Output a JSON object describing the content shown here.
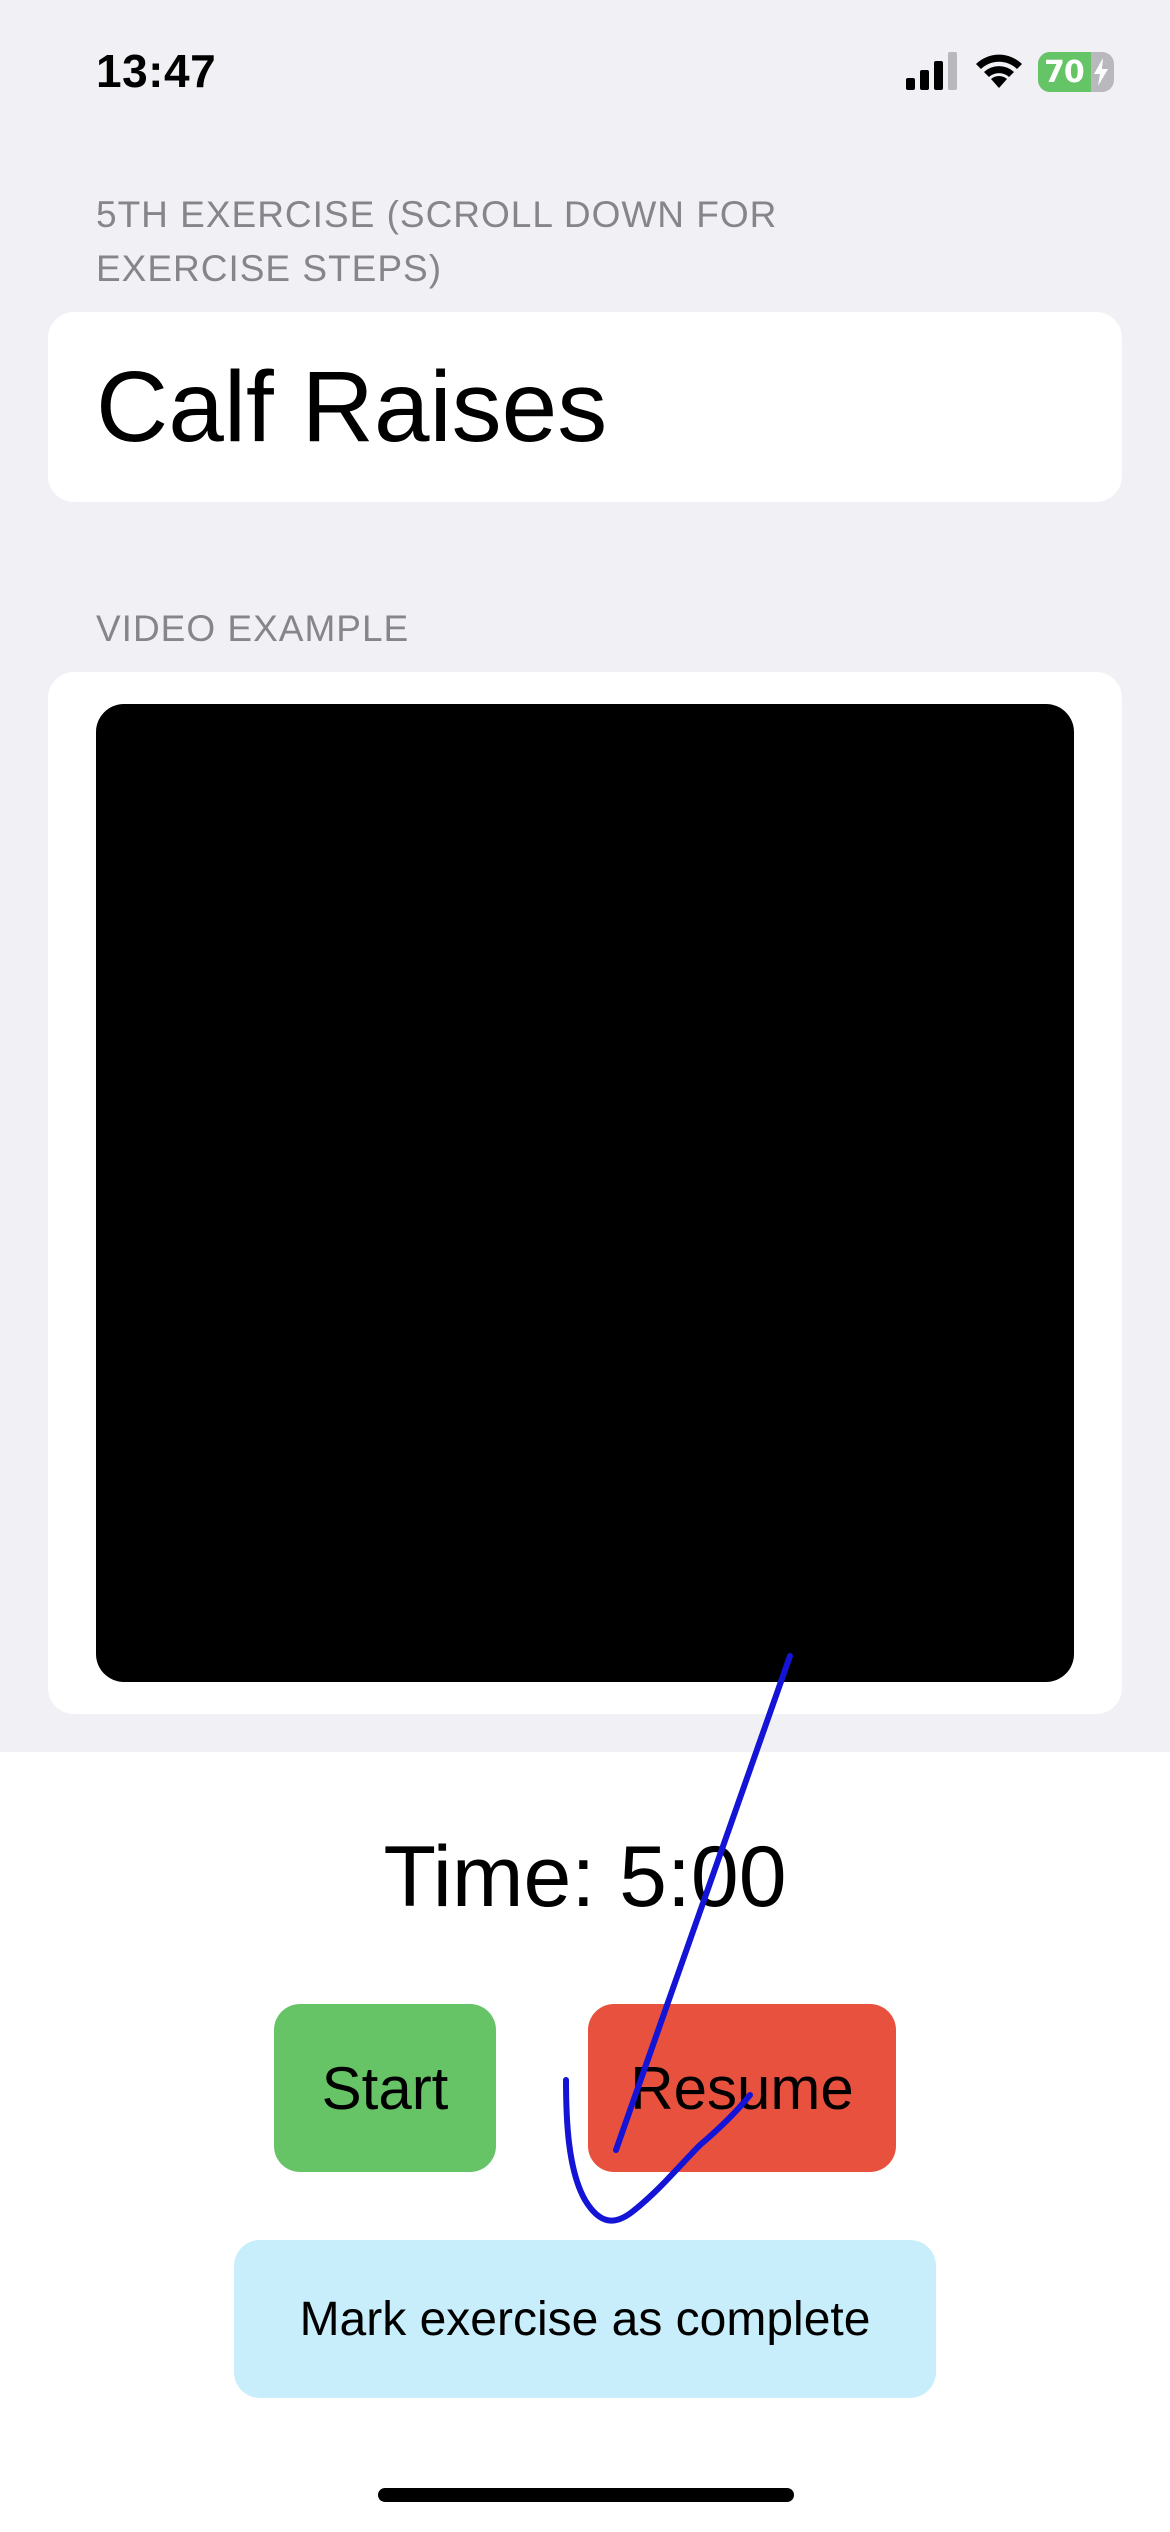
{
  "status_bar": {
    "time": "13:47",
    "battery_level": "70",
    "battery_fraction": 0.7,
    "icons": [
      "signal-icon",
      "wifi-icon",
      "battery-icon",
      "charging-bolt-icon"
    ]
  },
  "exercise_section": {
    "header": "5TH EXERCISE (SCROLL DOWN FOR EXERCISE STEPS)",
    "title": "Calf Raises"
  },
  "video_section": {
    "header": "VIDEO EXAMPLE"
  },
  "timer": {
    "label": "Time: 5:00"
  },
  "buttons": {
    "start_label": "Start",
    "resume_label": "Resume",
    "complete_label": "Mark exercise as complete"
  },
  "colors": {
    "background_gray": "#f1f0f5",
    "start_green": "#66c466",
    "resume_red": "#e9513f",
    "complete_blue": "#c7eefa",
    "annotation_ink": "#1414d6"
  }
}
